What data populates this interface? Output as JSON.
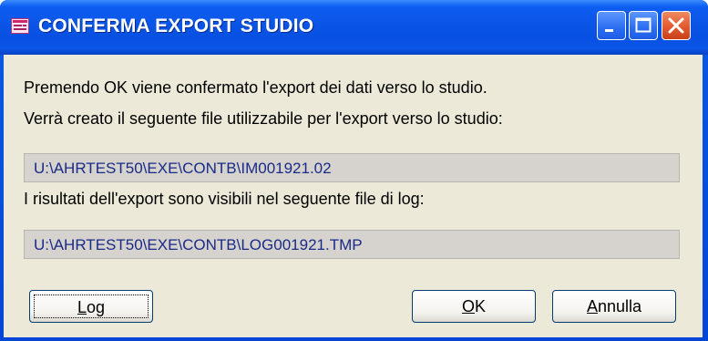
{
  "window": {
    "title": "CONFERMA EXPORT STUDIO"
  },
  "titlebar_buttons": [
    "minimize-icon",
    "maximize-icon",
    "close-icon"
  ],
  "message": {
    "line1": "Premendo OK viene confermato l'export dei dati verso lo studio.",
    "line2": "Verrà creato il seguente file utilizzabile per l'export verso lo studio:",
    "line3": "I risultati dell'export sono visibili nel seguente file di log:"
  },
  "fields": {
    "export_file": "U:\\AHRTEST50\\EXE\\CONTB\\IM001921.02",
    "log_file": "U:\\AHRTEST50\\EXE\\CONTB\\LOG001921.TMP"
  },
  "buttons": {
    "log": {
      "mnemonic": "L",
      "rest": "og"
    },
    "ok": {
      "mnemonic": "O",
      "rest": "K"
    },
    "cancel": {
      "mnemonic": "A",
      "rest": "nnulla"
    }
  },
  "colors": {
    "titlebar": "#0a55e6",
    "client_bg": "#ece9d8",
    "field_bg": "#d6d3ce",
    "field_text": "#1a2a88",
    "close_button": "#e25a2e"
  }
}
